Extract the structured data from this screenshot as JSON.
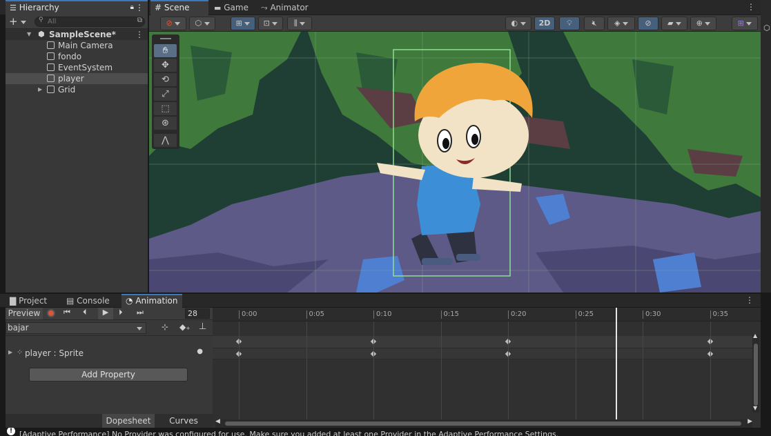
{
  "hierarchy": {
    "tab_label": "Hierarchy",
    "search_placeholder": "All",
    "scene_name": "SampleScene*",
    "items": [
      "Main Camera",
      "fondo",
      "EventSystem",
      "player",
      "Grid"
    ],
    "selected": "player"
  },
  "scene_view": {
    "tabs": [
      "Scene",
      "Game",
      "Animator"
    ],
    "mode_2d_label": "2D"
  },
  "bottom_panel": {
    "tabs": [
      "Project",
      "Console",
      "Animation"
    ]
  },
  "animation": {
    "preview_label": "Preview",
    "frame_value": "28",
    "clip_name": "bajar",
    "property_name": "player : Sprite",
    "add_property_label": "Add Property",
    "dopesheet_label": "Dopesheet",
    "curves_label": "Curves",
    "ruler_labels": [
      "0:00",
      "0:05",
      "0:10",
      "0:15",
      "0:20",
      "0:25",
      "0:30",
      "0:35"
    ],
    "keyframes": [
      "0:00",
      "0:10",
      "0:20",
      "0:35"
    ],
    "playhead": "0:28"
  },
  "status_bar": {
    "message": "[Adaptive Performance] No Provider was configured for use. Make sure you added at least one Provider in the Adaptive Performance Settings."
  },
  "colors": {
    "accent": "#3a79bb",
    "record": "#d9573c",
    "forest_dark": "#1f3f34",
    "forest_green": "#3f7a3c",
    "rock_purple": "#5d5a88",
    "water_blue": "#4f7fd0"
  }
}
